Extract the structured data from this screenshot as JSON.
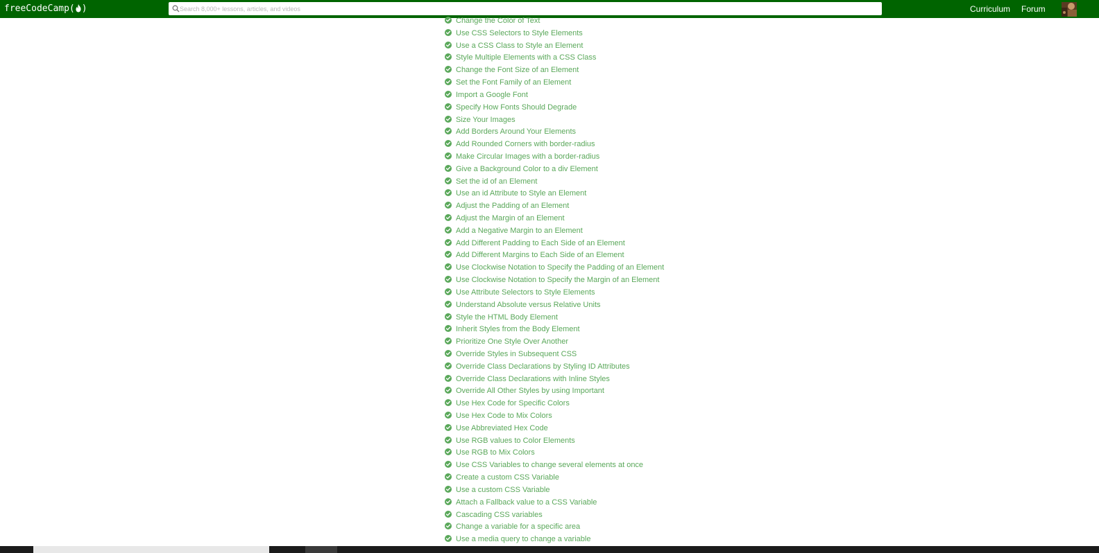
{
  "navbar": {
    "brand_text": "freeCodeCamp(",
    "brand_close": ")",
    "search_placeholder": "Search 8,000+ lessons, articles, and videos",
    "links": {
      "curriculum": "Curriculum",
      "forum": "Forum"
    },
    "background_color": "#006400"
  },
  "lessons": [
    "Change the Color of Text",
    "Use CSS Selectors to Style Elements",
    "Use a CSS Class to Style an Element",
    "Style Multiple Elements with a CSS Class",
    "Change the Font Size of an Element",
    "Set the Font Family of an Element",
    "Import a Google Font",
    "Specify How Fonts Should Degrade",
    "Size Your Images",
    "Add Borders Around Your Elements",
    "Add Rounded Corners with border-radius",
    "Make Circular Images with a border-radius",
    "Give a Background Color to a div Element",
    "Set the id of an Element",
    "Use an id Attribute to Style an Element",
    "Adjust the Padding of an Element",
    "Adjust the Margin of an Element",
    "Add a Negative Margin to an Element",
    "Add Different Padding to Each Side of an Element",
    "Add Different Margins to Each Side of an Element",
    "Use Clockwise Notation to Specify the Padding of an Element",
    "Use Clockwise Notation to Specify the Margin of an Element",
    "Use Attribute Selectors to Style Elements",
    "Understand Absolute versus Relative Units",
    "Style the HTML Body Element",
    "Inherit Styles from the Body Element",
    "Prioritize One Style Over Another",
    "Override Styles in Subsequent CSS",
    "Override Class Declarations by Styling ID Attributes",
    "Override Class Declarations with Inline Styles",
    "Override All Other Styles by using Important",
    "Use Hex Code for Specific Colors",
    "Use Hex Code to Mix Colors",
    "Use Abbreviated Hex Code",
    "Use RGB values to Color Elements",
    "Use RGB to Mix Colors",
    "Use CSS Variables to change several elements at once",
    "Create a custom CSS Variable",
    "Use a custom CSS Variable",
    "Attach a Fallback value to a CSS Variable",
    "Cascading CSS variables",
    "Change a variable for a specific area",
    "Use a media query to change a variable"
  ],
  "lesson_status_icon": "check-circle-icon",
  "accent_color": "#5aa85a"
}
